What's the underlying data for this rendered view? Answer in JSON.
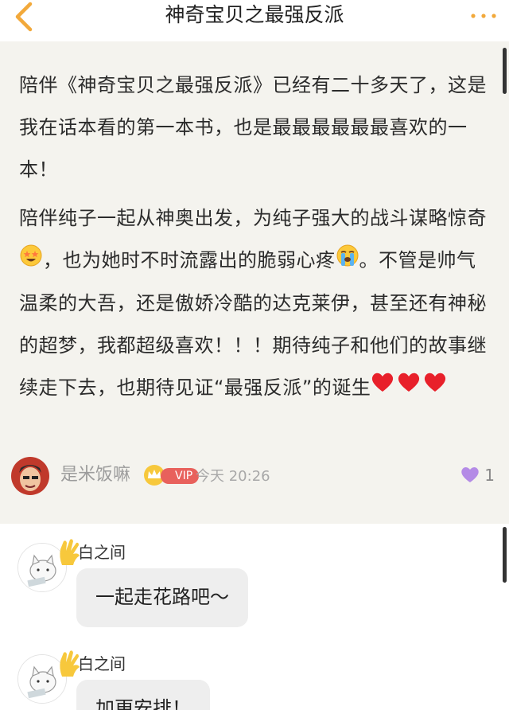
{
  "header": {
    "title": "神奇宝贝之最强反派",
    "back_icon": "chevron-left-icon",
    "more_icon": "more-dots-icon",
    "accent_color": "#f2a93b"
  },
  "post": {
    "paragraphs": [
      {
        "text": "陪伴《神奇宝贝之最强反派》已经有二十多天了，这是我在话本看的第一本书，也是最最最最最最喜欢的一本！"
      },
      {
        "part1": "陪伴纯子一起从神奥出发，为纯子强大的战斗谋略惊奇",
        "emoji1": "star-struck-emoji",
        "part2": "，也为她时不时流露出的脆弱心疼",
        "emoji2": "crying-emoji",
        "part3": "。不管是帅气温柔的大吾，还是傲娇冷酷的达克莱伊，甚至还有神秘的超梦，我都超级喜欢！！！期待纯子和他们的故事继续走下去，也期待见证“最强反派”的诞生",
        "emoji3": "red-heart-emoji ×3"
      }
    ],
    "author": {
      "name": "是米饭嘛",
      "vip_label": "VIP",
      "time": "今天 20:26"
    },
    "likes": "1",
    "like_color": "#b48be6"
  },
  "comments": [
    {
      "name": "白之间",
      "text": "一起走花路吧～"
    },
    {
      "name": "白之间",
      "text": "加更安排！"
    }
  ]
}
